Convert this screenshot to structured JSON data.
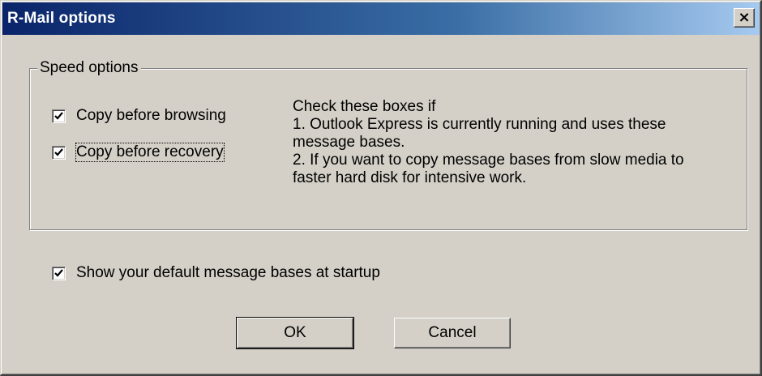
{
  "window": {
    "title": "R-Mail options",
    "close_glyph": "×"
  },
  "speed_options": {
    "group_label": "Speed options",
    "copy_before_browsing": {
      "label": "Copy before browsing",
      "checked": true
    },
    "copy_before_recovery": {
      "label": "Copy before recovery",
      "checked": true
    },
    "help_lines": [
      "Check these boxes if",
      "1. Outlook Express is currently running and uses these",
      "message bases.",
      "2. If you want to copy message bases from slow media to",
      "faster hard disk for intensive work."
    ]
  },
  "startup": {
    "show_default_bases": {
      "label": "Show your default message bases at startup",
      "checked": true
    }
  },
  "buttons": {
    "ok_label": "OK",
    "cancel_label": "Cancel"
  },
  "colors": {
    "face": "#d4d0c8",
    "title_start": "#0a246a",
    "title_end": "#a6caf0"
  }
}
